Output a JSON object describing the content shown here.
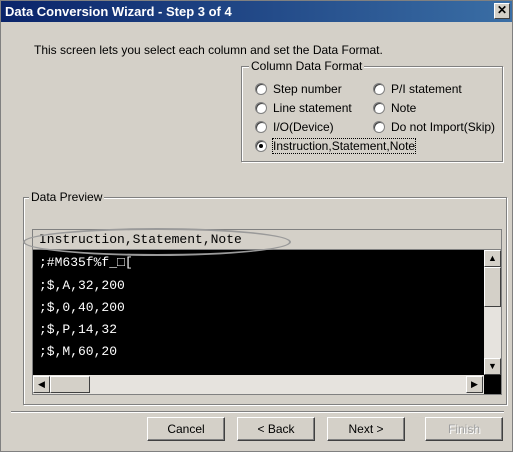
{
  "window": {
    "title": "Data Conversion Wizard - Step 3 of 4",
    "close_glyph": "✕"
  },
  "description": "This screen lets you select each column and set the Data Format.",
  "column_format": {
    "label": "Column Data Format",
    "options": [
      {
        "label": "Step number",
        "selected": false
      },
      {
        "label": "P/I statement",
        "selected": false
      },
      {
        "label": "Line statement",
        "selected": false
      },
      {
        "label": "Note",
        "selected": false
      },
      {
        "label": "I/O(Device)",
        "selected": false
      },
      {
        "label": "Do not Import(Skip)",
        "selected": false
      },
      {
        "label": "Instruction,Statement,Note",
        "selected": true
      }
    ]
  },
  "preview": {
    "label": "Data Preview",
    "column_header": "Instruction,Statement,Note",
    "rows": [
      ";#M635f%f_□[",
      ";$,A,32,200",
      ";$,0,40,200",
      ";$,P,14,32",
      ";$,M,60,20"
    ]
  },
  "buttons": {
    "cancel": "Cancel",
    "back": "< Back",
    "next": "Next >",
    "finish": "Finish"
  }
}
